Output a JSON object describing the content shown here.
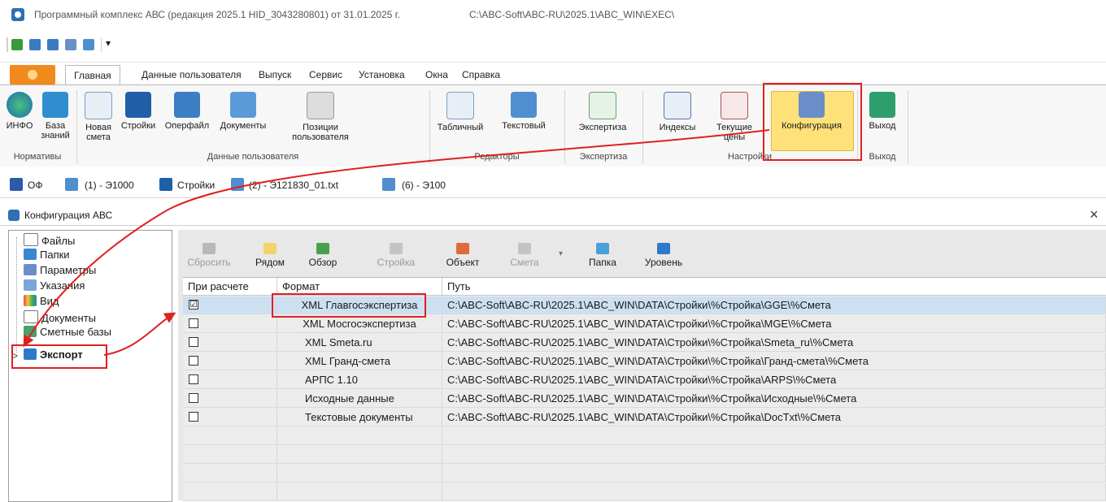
{
  "title": {
    "app": "Программный комплекс АВС (редакция 2025.1 HID_3043280801) от 31.01.2025 г.",
    "path": "C:\\ABC-Soft\\ABC-RU\\2025.1\\ABC_WIN\\EXEC\\"
  },
  "tabs": [
    "Главная",
    "Данные пользователя",
    "Выпуск",
    "Сервис",
    "Установка",
    "Окна",
    "Справка"
  ],
  "ribbon": {
    "buttons": {
      "info": "ИНФО",
      "kb1": "База",
      "kb2": "знаний",
      "newest1": "Новая",
      "newest2": "смета",
      "stroyki": "Стройки",
      "operfile": "Оперфайл",
      "docs": "Документы",
      "pos1": "Позиции",
      "pos2": "пользователя",
      "tabular": "Табличный",
      "text": "Текстовый",
      "expertise": "Экспертиза",
      "indexes": "Индексы",
      "prices1": "Текущие",
      "prices2": "цены",
      "config": "Конфигурация",
      "exit": "Выход"
    },
    "groups": {
      "norm": "Нормативы",
      "userdata": "Данные пользователя",
      "editors": "Редакторы",
      "expertise": "Экспертиза",
      "settings": "Настройки",
      "exit": "Выход"
    }
  },
  "docstrip": [
    "ОФ",
    "(1) - Э1000",
    "Стройки",
    "(2) - Э121830_01.txt",
    "(6) - Э100"
  ],
  "window": {
    "title": "Конфигурация АВС",
    "close": "×"
  },
  "tree": [
    "Файлы",
    "Папки",
    "Параметры",
    "Указания",
    "Вид",
    "Документы",
    "Сметные базы",
    "Экспорт"
  ],
  "tree_expander": ">",
  "toolbar": {
    "reset": "Сбросить",
    "nearby": "Рядом",
    "browse": "Обзор",
    "stroyka": "Стройка",
    "object": "Объект",
    "smeta": "Смета",
    "folder": "Папка",
    "level": "Уровень"
  },
  "grid": {
    "headers": {
      "calc": "При расчете",
      "format": "Формат",
      "path": "Путь"
    },
    "rows": [
      {
        "checked": "☑",
        "format": "XML Главгосэкспертиза",
        "path": "C:\\ABC-Soft\\ABC-RU\\2025.1\\ABC_WIN\\DATA\\Стройки\\%Стройка\\GGE\\%Смета"
      },
      {
        "checked": "",
        "format": "XML Мосгосэкспертиза",
        "path": "C:\\ABC-Soft\\ABC-RU\\2025.1\\ABC_WIN\\DATA\\Стройки\\%Стройка\\MGE\\%Смета"
      },
      {
        "checked": "",
        "format": "XML Smeta.ru",
        "path": "C:\\ABC-Soft\\ABC-RU\\2025.1\\ABC_WIN\\DATA\\Стройки\\%Стройка\\Smeta_ru\\%Смета"
      },
      {
        "checked": "",
        "format": "XML Гранд-смета",
        "path": "C:\\ABC-Soft\\ABC-RU\\2025.1\\ABC_WIN\\DATA\\Стройки\\%Стройка\\Гранд-смета\\%Смета"
      },
      {
        "checked": "",
        "format": "АРПС 1.10",
        "path": "C:\\ABC-Soft\\ABC-RU\\2025.1\\ABC_WIN\\DATA\\Стройки\\%Стройка\\ARPS\\%Смета"
      },
      {
        "checked": "",
        "format": "Исходные данные",
        "path": "C:\\ABC-Soft\\ABC-RU\\2025.1\\ABC_WIN\\DATA\\Стройки\\%Стройка\\Исходные\\%Смета"
      },
      {
        "checked": "",
        "format": "Текстовые документы",
        "path": "C:\\ABC-Soft\\ABC-RU\\2025.1\\ABC_WIN\\DATA\\Стройки\\%Стройка\\DocTxt\\%Смета"
      }
    ]
  },
  "colors": {
    "accent": "#2f6fb5",
    "highlight": "#ffe17a",
    "annotation": "#e02020",
    "selection": "#cde0f2"
  }
}
